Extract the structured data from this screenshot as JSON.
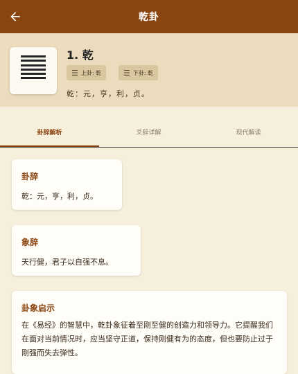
{
  "appbar": {
    "title": "乾卦",
    "back_icon": "arrow-left-icon"
  },
  "hexagram": {
    "name": "1. 乾",
    "upper_tag": "上卦: 乾",
    "lower_tag": "下卦: 乾",
    "judgment_short": "乾：元，亨，利，贞。"
  },
  "tabs": [
    {
      "label": "卦辞解析",
      "active": true
    },
    {
      "label": "爻辞详解",
      "active": false
    },
    {
      "label": "现代解读",
      "active": false
    }
  ],
  "cards": [
    {
      "title": "卦辞",
      "body": "乾：元，亨，利，贞。"
    },
    {
      "title": "象辞",
      "body": "天行健，君子以自强不息。"
    },
    {
      "title": "卦象启示",
      "body": "在《易经》的智慧中，乾卦象征着至刚至健的创造力和领导力。它提醒我们在面对当前情况时，应当坚守正道，保持刚健有为的态度，但也要防止过于刚强而失去弹性。"
    }
  ],
  "colors": {
    "appbar": "#8b4511",
    "header_bg": "#eadcbc",
    "page_bg": "#f6efdc",
    "accent": "#8b4511"
  }
}
